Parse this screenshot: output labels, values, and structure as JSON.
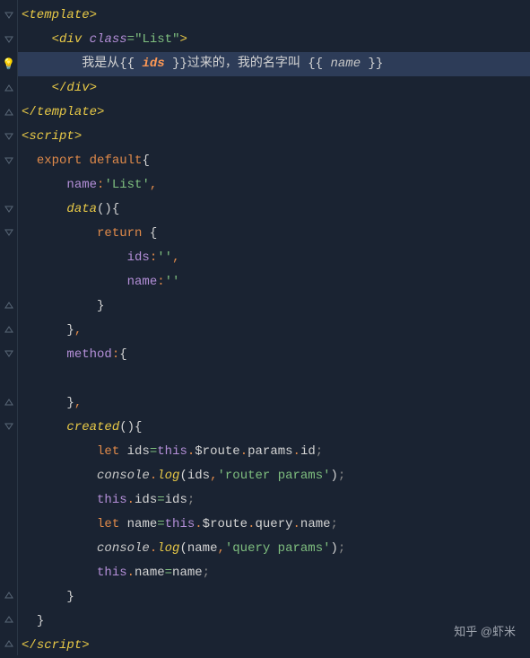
{
  "gutter": [
    {
      "type": "fold-down"
    },
    {
      "type": "fold-down"
    },
    {
      "type": "bulb"
    },
    {
      "type": "fold-up"
    },
    {
      "type": "fold-up"
    },
    {
      "type": "fold-down"
    },
    {
      "type": "fold-down"
    },
    {
      "type": "none"
    },
    {
      "type": "fold-down"
    },
    {
      "type": "fold-down"
    },
    {
      "type": "none"
    },
    {
      "type": "none"
    },
    {
      "type": "fold-up"
    },
    {
      "type": "fold-up"
    },
    {
      "type": "fold-down"
    },
    {
      "type": "none"
    },
    {
      "type": "fold-up"
    },
    {
      "type": "fold-down"
    },
    {
      "type": "none"
    },
    {
      "type": "none"
    },
    {
      "type": "none"
    },
    {
      "type": "none"
    },
    {
      "type": "none"
    },
    {
      "type": "none"
    },
    {
      "type": "fold-up"
    },
    {
      "type": "fold-up"
    },
    {
      "type": "fold-up"
    }
  ],
  "code": {
    "l1": {
      "tag_open": "<",
      "tag": "template",
      "tag_close": ">"
    },
    "l2": {
      "tag_open": "<",
      "tag": "div",
      "sp": " ",
      "attr": "class",
      "eq": "=",
      "str": "\"List\"",
      "tag_close": ">"
    },
    "l3": {
      "txt1": "我是从",
      "dl": "{{",
      "sp1": " ",
      "v1": "ids",
      "sp2": " ",
      "dr": "}}",
      "txt2": "过来的，我的名字叫 ",
      "dl2": "{{",
      "sp3": " ",
      "v2": "name",
      "sp4": " ",
      "dr2": "}}"
    },
    "l4": {
      "tag_open": "</",
      "tag": "div",
      "tag_close": ">"
    },
    "l5": {
      "tag_open": "</",
      "tag": "template",
      "tag_close": ">"
    },
    "l6": {
      "tag_open": "<",
      "tag": "script",
      "tag_close": ">"
    },
    "l7": {
      "kw1": "export",
      "sp": " ",
      "kw2": "default",
      "brace": "{"
    },
    "l8": {
      "prop": "name",
      "colon": ":",
      "str": "'List'",
      "comma": ","
    },
    "l9": {
      "prop": "data",
      "paren": "()",
      "brace": "{"
    },
    "l10": {
      "kw": "return",
      "sp": " ",
      "brace": "{"
    },
    "l11": {
      "prop": "ids",
      "colon": ":",
      "str": "''",
      "comma": ","
    },
    "l12": {
      "prop": "name",
      "colon": ":",
      "str": "''"
    },
    "l13": {
      "brace": "}"
    },
    "l14": {
      "brace": "}",
      "comma": ","
    },
    "l15": {
      "prop": "method",
      "colon": ":",
      "brace": "{"
    },
    "l16": {
      "empty": " "
    },
    "l17": {
      "brace": "}",
      "comma": ","
    },
    "l18": {
      "prop": "created",
      "paren": "()",
      "brace": "{"
    },
    "l19": {
      "kw": "let",
      "sp": " ",
      "id": "ids",
      "eq": "=",
      "this": "this",
      "dot1": ".",
      "r": "$route",
      "dot2": ".",
      "p": "params",
      "dot3": ".",
      "i": "id",
      "semi": ";"
    },
    "l20": {
      "con": "console",
      "dot": ".",
      "log": "log",
      "op": "(",
      "id": "ids",
      "comma": ",",
      "str": "'router params'",
      "cp": ")",
      "semi": ";"
    },
    "l21": {
      "this": "this",
      "dot": ".",
      "id": "ids",
      "eq": "=",
      "id2": "ids",
      "semi": ";"
    },
    "l22": {
      "kw": "let",
      "sp": " ",
      "id": "name",
      "eq": "=",
      "this": "this",
      "dot1": ".",
      "r": "$route",
      "dot2": ".",
      "p": "query",
      "dot3": ".",
      "i": "name",
      "semi": ";"
    },
    "l23": {
      "con": "console",
      "dot": ".",
      "log": "log",
      "op": "(",
      "id": "name",
      "comma": ",",
      "str": "'query params'",
      "cp": ")",
      "semi": ";"
    },
    "l24": {
      "this": "this",
      "dot": ".",
      "id": "name",
      "eq": "=",
      "id2": "name",
      "semi": ";"
    },
    "l25": {
      "brace": "}"
    },
    "l26": {
      "brace": "}"
    },
    "l27": {
      "tag_open": "</",
      "tag": "script",
      "tag_close": ">"
    }
  },
  "watermark": "知乎 @虾米"
}
